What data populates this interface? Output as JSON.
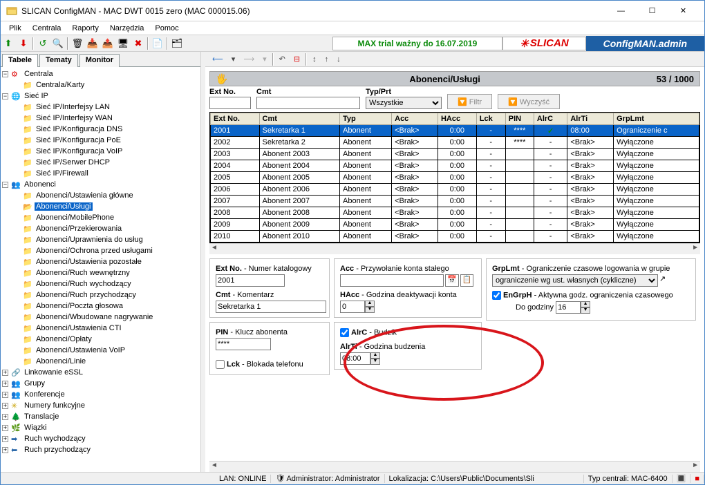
{
  "window": {
    "title": "SLICAN ConfigMAN - MAC DWT 0015 zero (MAC 000015.06)"
  },
  "menu": [
    "Plik",
    "Centrala",
    "Raporty",
    "Narzędzia",
    "Pomoc"
  ],
  "banner": {
    "trial": "MAX trial ważny do 16.07.2019",
    "brand": "SLICAN",
    "app": "ConfigMAN.admin"
  },
  "tabs": {
    "tabele": "Tabele",
    "tematy": "Tematy",
    "monitor": "Monitor"
  },
  "tree": {
    "centrala": "Centrala",
    "centrala_karty": "Centrala/Karty",
    "siec_ip": "Sieć IP",
    "s_lan": "Sieć IP/Interfejsy LAN",
    "s_wan": "Sieć IP/Interfejsy WAN",
    "s_dns": "Sieć IP/Konfiguracja DNS",
    "s_poe": "Sieć IP/Konfiguracja PoE",
    "s_voip": "Sieć IP/Konfiguracja VoIP",
    "s_dhcp": "Sieć IP/Serwer DHCP",
    "s_fw": "Sieć IP/Firewall",
    "abonenci": "Abonenci",
    "a_ust_gl": "Abonenci/Ustawienia główne",
    "a_uslugi": "Abonenci/Usługi",
    "a_mobile": "Abonenci/MobilePhone",
    "a_przek": "Abonenci/Przekierowania",
    "a_upr": "Abonenci/Uprawnienia do usług",
    "a_ochr": "Abonenci/Ochrona przed usługami",
    "a_ust_poz": "Abonenci/Ustawienia pozostałe",
    "a_rw": "Abonenci/Ruch wewnętrzny",
    "a_rwy": "Abonenci/Ruch wychodzący",
    "a_rprz": "Abonenci/Ruch przychodzący",
    "a_poczta": "Abonenci/Poczta głosowa",
    "a_nagr": "Abonenci/Wbudowane nagrywanie",
    "a_cti": "Abonenci/Ustawienia CTI",
    "a_oplaty": "Abonenci/Opłaty",
    "a_ust_voip": "Abonenci/Ustawienia VoIP",
    "a_linie": "Abonenci/Linie",
    "link_essl": "Linkowanie eSSL",
    "grupy": "Grupy",
    "konferencje": "Konferencje",
    "numery_f": "Numery funkcyjne",
    "translacje": "Translacje",
    "wiazki": "Wiązki",
    "ruch_wy": "Ruch wychodzący",
    "ruch_prz": "Ruch przychodzący"
  },
  "header": {
    "title": "Abonenci/Usługi",
    "count": "53 / 1000"
  },
  "filter": {
    "extno": "Ext No.",
    "cmt": "Cmt",
    "typprt": "Typ/Prt",
    "typprt_val": "Wszystkie",
    "filtr": "Filtr",
    "wyczysc": "Wyczyść"
  },
  "cols": [
    "Ext No.",
    "Cmt",
    "Typ",
    "Acc",
    "HAcc",
    "Lck",
    "PIN",
    "AlrC",
    "AlrTi",
    "GrpLmt"
  ],
  "rows": [
    {
      "ext": "2001",
      "cmt": "Sekretarka 1",
      "typ": "Abonent",
      "acc": "<Brak>",
      "hacc": "0:00",
      "lck": "-",
      "pin": "****",
      "alrc": "✓",
      "alrti": "08:00",
      "grp": "Ograniczenie c"
    },
    {
      "ext": "2002",
      "cmt": "Sekretarka 2",
      "typ": "Abonent",
      "acc": "<Brak>",
      "hacc": "0:00",
      "lck": "-",
      "pin": "****",
      "alrc": "-",
      "alrti": "<Brak>",
      "grp": "Wyłączone"
    },
    {
      "ext": "2003",
      "cmt": "Abonent 2003",
      "typ": "Abonent",
      "acc": "<Brak>",
      "hacc": "0:00",
      "lck": "-",
      "pin": "",
      "alrc": "-",
      "alrti": "<Brak>",
      "grp": "Wyłączone"
    },
    {
      "ext": "2004",
      "cmt": "Abonent 2004",
      "typ": "Abonent",
      "acc": "<Brak>",
      "hacc": "0:00",
      "lck": "-",
      "pin": "",
      "alrc": "-",
      "alrti": "<Brak>",
      "grp": "Wyłączone"
    },
    {
      "ext": "2005",
      "cmt": "Abonent 2005",
      "typ": "Abonent",
      "acc": "<Brak>",
      "hacc": "0:00",
      "lck": "-",
      "pin": "",
      "alrc": "-",
      "alrti": "<Brak>",
      "grp": "Wyłączone"
    },
    {
      "ext": "2006",
      "cmt": "Abonent 2006",
      "typ": "Abonent",
      "acc": "<Brak>",
      "hacc": "0:00",
      "lck": "-",
      "pin": "",
      "alrc": "-",
      "alrti": "<Brak>",
      "grp": "Wyłączone"
    },
    {
      "ext": "2007",
      "cmt": "Abonent 2007",
      "typ": "Abonent",
      "acc": "<Brak>",
      "hacc": "0:00",
      "lck": "-",
      "pin": "",
      "alrc": "-",
      "alrti": "<Brak>",
      "grp": "Wyłączone"
    },
    {
      "ext": "2008",
      "cmt": "Abonent 2008",
      "typ": "Abonent",
      "acc": "<Brak>",
      "hacc": "0:00",
      "lck": "-",
      "pin": "",
      "alrc": "-",
      "alrti": "<Brak>",
      "grp": "Wyłączone"
    },
    {
      "ext": "2009",
      "cmt": "Abonent 2009",
      "typ": "Abonent",
      "acc": "<Brak>",
      "hacc": "0:00",
      "lck": "-",
      "pin": "",
      "alrc": "-",
      "alrti": "<Brak>",
      "grp": "Wyłączone"
    },
    {
      "ext": "2010",
      "cmt": "Abonent 2010",
      "typ": "Abonent",
      "acc": "<Brak>",
      "hacc": "0:00",
      "lck": "-",
      "pin": "",
      "alrc": "-",
      "alrti": "<Brak>",
      "grp": "Wyłączone"
    }
  ],
  "detail": {
    "extno_lbl": "Ext No.",
    "extno_desc": " - Numer katalogowy",
    "extno_val": "2001",
    "cmt_lbl": "Cmt",
    "cmt_desc": " - Komentarz",
    "cmt_val": "Sekretarka 1",
    "pin_lbl": "PIN",
    "pin_desc": " - Klucz abonenta",
    "pin_val": "****",
    "lck_lbl": "Lck",
    "lck_desc": " -  Blokada telefonu",
    "acc_lbl": "Acc",
    "acc_desc": " - Przywołanie konta stałego",
    "hacc_lbl": "HAcc",
    "hacc_desc": " - Godzina deaktywacji konta",
    "hacc_val": "0",
    "alrc_lbl": "AlrC",
    "alrc_desc": " -  Budzik",
    "alrti_lbl": "AlrTi",
    "alrti_desc": " - Godzina budzenia",
    "alrti_val": "08:00",
    "grplmt_lbl": "GrpLmt",
    "grplmt_desc": " - Ograniczenie czasowe logowania w grupie",
    "grplmt_val": "ograniczenie wg ust. własnych (cykliczne)",
    "engrph_lbl": "EnGrpH",
    "engrph_desc": " -  Aktywna godz. ograniczenia czasowego",
    "dogodz": "Do godziny",
    "dogodz_val": "16"
  },
  "status": {
    "lan": "LAN: ONLINE",
    "admin": "Administrator: Administrator",
    "lok": "Lokalizacja: C:\\Users\\Public\\Documents\\Sli",
    "typ": "Typ centrali: MAC-6400"
  }
}
